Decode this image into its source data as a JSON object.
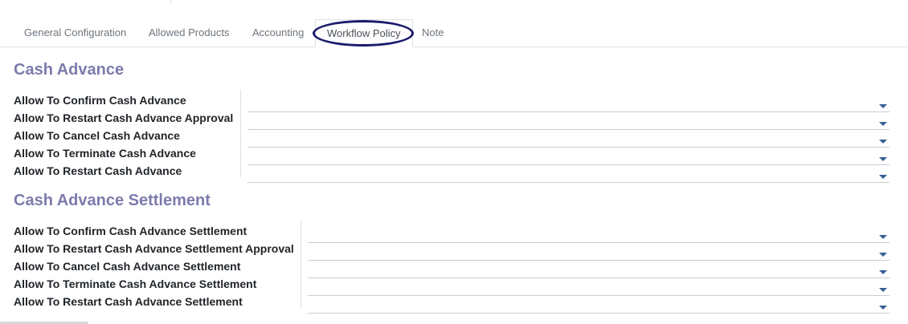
{
  "tabs": [
    {
      "label": "General Configuration",
      "active": false
    },
    {
      "label": "Allowed Products",
      "active": false
    },
    {
      "label": "Accounting",
      "active": false
    },
    {
      "label": "Workflow Policy",
      "active": true
    },
    {
      "label": "Note",
      "active": false
    }
  ],
  "colors": {
    "section_title": "#7c7bad",
    "highlight_circle": "#1b1b6e",
    "caret": "#365e96"
  },
  "cash_advance": {
    "title": "Cash Advance",
    "fields": [
      {
        "label": "Allow To Confirm Cash Advance",
        "value": ""
      },
      {
        "label": "Allow To Restart Cash Advance Approval",
        "value": ""
      },
      {
        "label": "Allow To Cancel Cash Advance",
        "value": ""
      },
      {
        "label": "Allow To Terminate Cash Advance",
        "value": ""
      },
      {
        "label": "Allow To Restart Cash Advance",
        "value": ""
      }
    ]
  },
  "settlement": {
    "title": "Cash Advance Settlement",
    "fields": [
      {
        "label": "Allow To Confirm Cash Advance Settlement",
        "value": ""
      },
      {
        "label": "Allow To Restart Cash Advance Settlement Approval",
        "value": ""
      },
      {
        "label": "Allow To Cancel Cash Advance Settlement",
        "value": ""
      },
      {
        "label": "Allow To Terminate Cash Advance Settlement",
        "value": ""
      },
      {
        "label": "Allow To Restart Cash Advance Settlement",
        "value": ""
      }
    ]
  }
}
